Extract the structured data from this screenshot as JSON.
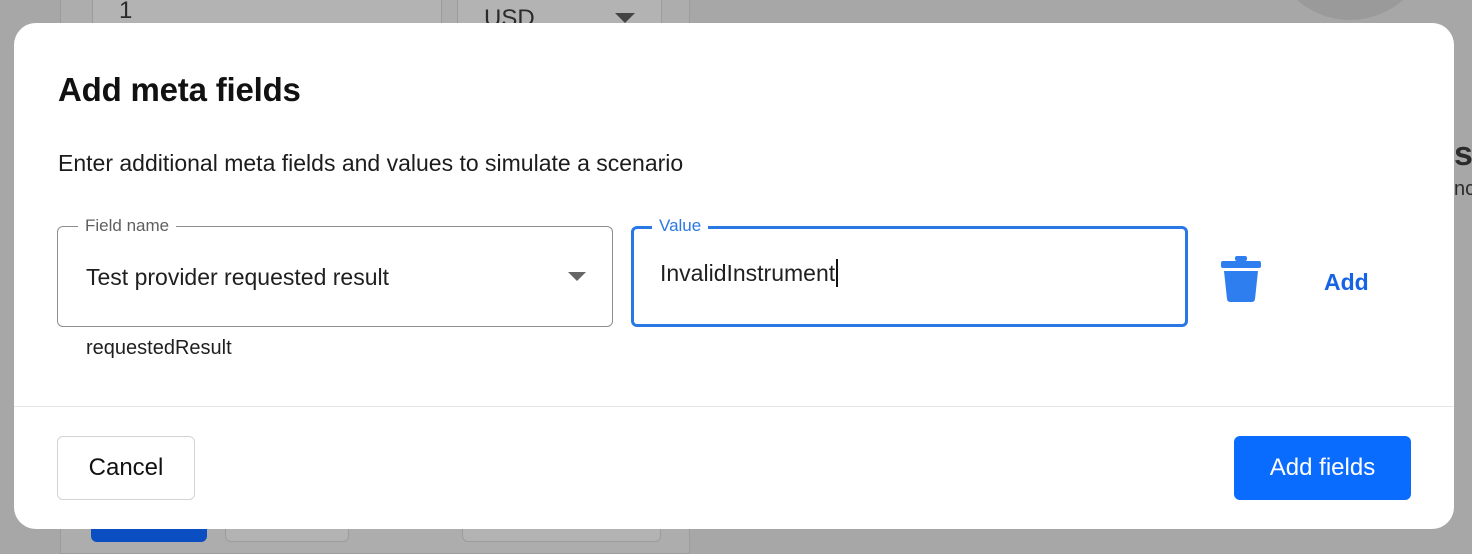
{
  "background": {
    "quantity_value": "1",
    "currency_value": "USD",
    "right_letter": "s",
    "right_fragment": "nc"
  },
  "modal": {
    "title": "Add meta fields",
    "description": "Enter additional meta fields and values to simulate a scenario",
    "field_name": {
      "label": "Field name",
      "selected": "Test provider requested result",
      "helper": "requestedResult"
    },
    "value": {
      "label": "Value",
      "current": "InvalidInstrument"
    },
    "add_label": "Add",
    "cancel_label": "Cancel",
    "submit_label": "Add fields"
  },
  "colors": {
    "accent": "#0a6cff",
    "focus": "#2a78e4",
    "link": "#1663e6",
    "trash": "#2f7ef0"
  },
  "icons": {
    "delete": "trash-icon",
    "select": "chevron-down-icon"
  }
}
